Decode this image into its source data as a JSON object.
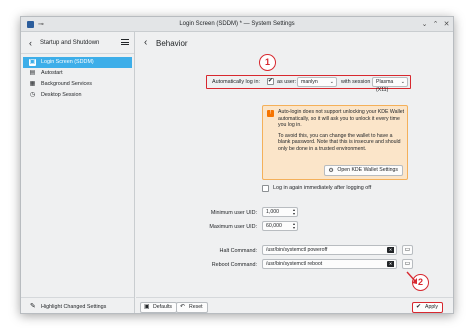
{
  "window": {
    "title": "Login Screen (SDDM) * — System Settings",
    "pin_glyph": "⊸",
    "minimize_glyph": "⌄",
    "maximize_glyph": "⌃",
    "close_glyph": "✕"
  },
  "sidebar": {
    "back_glyph": "‹",
    "header_title": "Startup and Shutdown",
    "items": [
      {
        "label": "Login Screen (SDDM)",
        "icon": "login-screen-icon",
        "glyph": "▣",
        "active": true
      },
      {
        "label": "Autostart",
        "icon": "autostart-icon",
        "glyph": "▤",
        "active": false
      },
      {
        "label": "Background Services",
        "icon": "background-services-icon",
        "glyph": "▦",
        "active": false
      },
      {
        "label": "Desktop Session",
        "icon": "desktop-session-icon",
        "glyph": "◷",
        "active": false
      }
    ],
    "footer_label": "Highlight Changed Settings",
    "footer_glyph": "✎"
  },
  "main": {
    "back_glyph": "‹",
    "page_title": "Behavior",
    "autologin": {
      "label": "Automatically log in:",
      "checked": true,
      "as_user_label": "as user:",
      "user_value": "manlyn",
      "with_session_label": "with session",
      "session_value": "Plasma (X11)"
    },
    "warning": {
      "text_1": "Auto-login does not support unlocking your KDE Wallet automatically, so it will ask you to unlock it every time you log in.",
      "text_2": "To avoid this, you can change the wallet to have a blank password. Note that this is insecure and should only be done in a trusted environment.",
      "button_label": "Open KDE Wallet Settings",
      "button_glyph": "⚙",
      "icon_glyph": "!"
    },
    "relogin_label": "Log in again immediately after logging off",
    "min_uid_label": "Minimum user UID:",
    "min_uid_value": "1,000",
    "max_uid_label": "Maximum user UID:",
    "max_uid_value": "60,000",
    "halt_label": "Halt Command:",
    "halt_value": "/usr/bin/systemctl poweroff",
    "reboot_label": "Reboot Command:",
    "reboot_value": "/usr/bin/systemctl reboot",
    "combo_arrow": "⌄",
    "spin_up": "▴",
    "spin_down": "▾",
    "clear_glyph": "✕",
    "folder_glyph": "▭"
  },
  "footer": {
    "defaults_label": "Defaults",
    "defaults_glyph": "▣",
    "reset_label": "Reset",
    "reset_glyph": "↶",
    "apply_label": "Apply",
    "apply_glyph": "✔"
  },
  "annotations": {
    "callout_1": "1",
    "callout_2": "2",
    "color": "#d7282f"
  }
}
